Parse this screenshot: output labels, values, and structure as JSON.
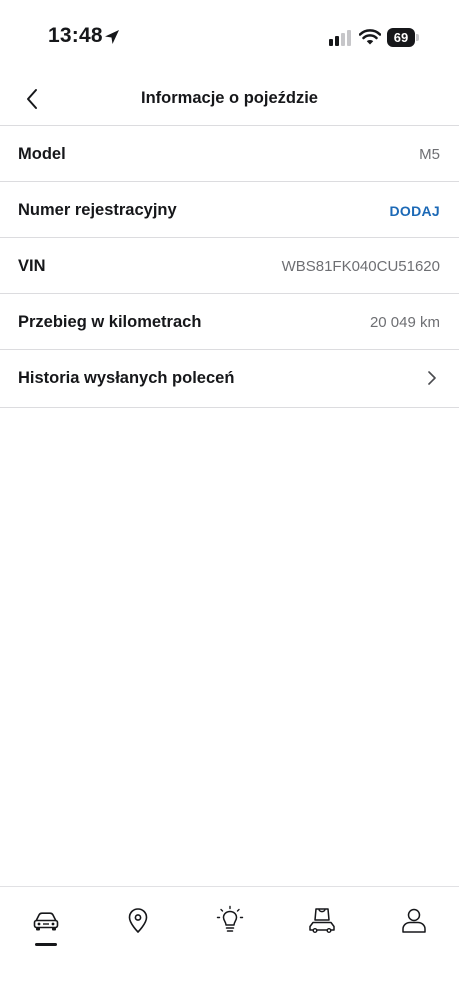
{
  "status_bar": {
    "time": "13:48",
    "battery_level": "69",
    "icons": [
      "location-arrow-icon",
      "cellular-signal-icon",
      "wifi-icon",
      "battery-icon"
    ]
  },
  "header": {
    "title": "Informacje o pojeździe",
    "back_icon": "chevron-left-icon"
  },
  "vehicle_info": {
    "model": {
      "label": "Model",
      "value": "M5"
    },
    "registration": {
      "label": "Numer rejestracyjny",
      "action": "DODAJ"
    },
    "vin": {
      "label": "VIN",
      "value": "WBS81FK040CU51620"
    },
    "mileage": {
      "label": "Przebieg w kilometrach",
      "value": "20 049 km"
    },
    "history": {
      "label": "Historia wysłanych poleceń",
      "icon": "chevron-right-icon"
    }
  },
  "colors": {
    "accent": "#1c69b6",
    "text_primary": "#16171a",
    "text_secondary": "#6e6f73",
    "divider": "#dcdcdf"
  },
  "tab_bar": {
    "active_tab": "vehicle",
    "tabs": [
      {
        "id": "vehicle",
        "icon": "car-icon"
      },
      {
        "id": "map",
        "icon": "map-pin-icon"
      },
      {
        "id": "discover",
        "icon": "lightbulb-icon"
      },
      {
        "id": "shop",
        "icon": "shop-car-icon"
      },
      {
        "id": "profile",
        "icon": "profile-icon"
      }
    ]
  }
}
